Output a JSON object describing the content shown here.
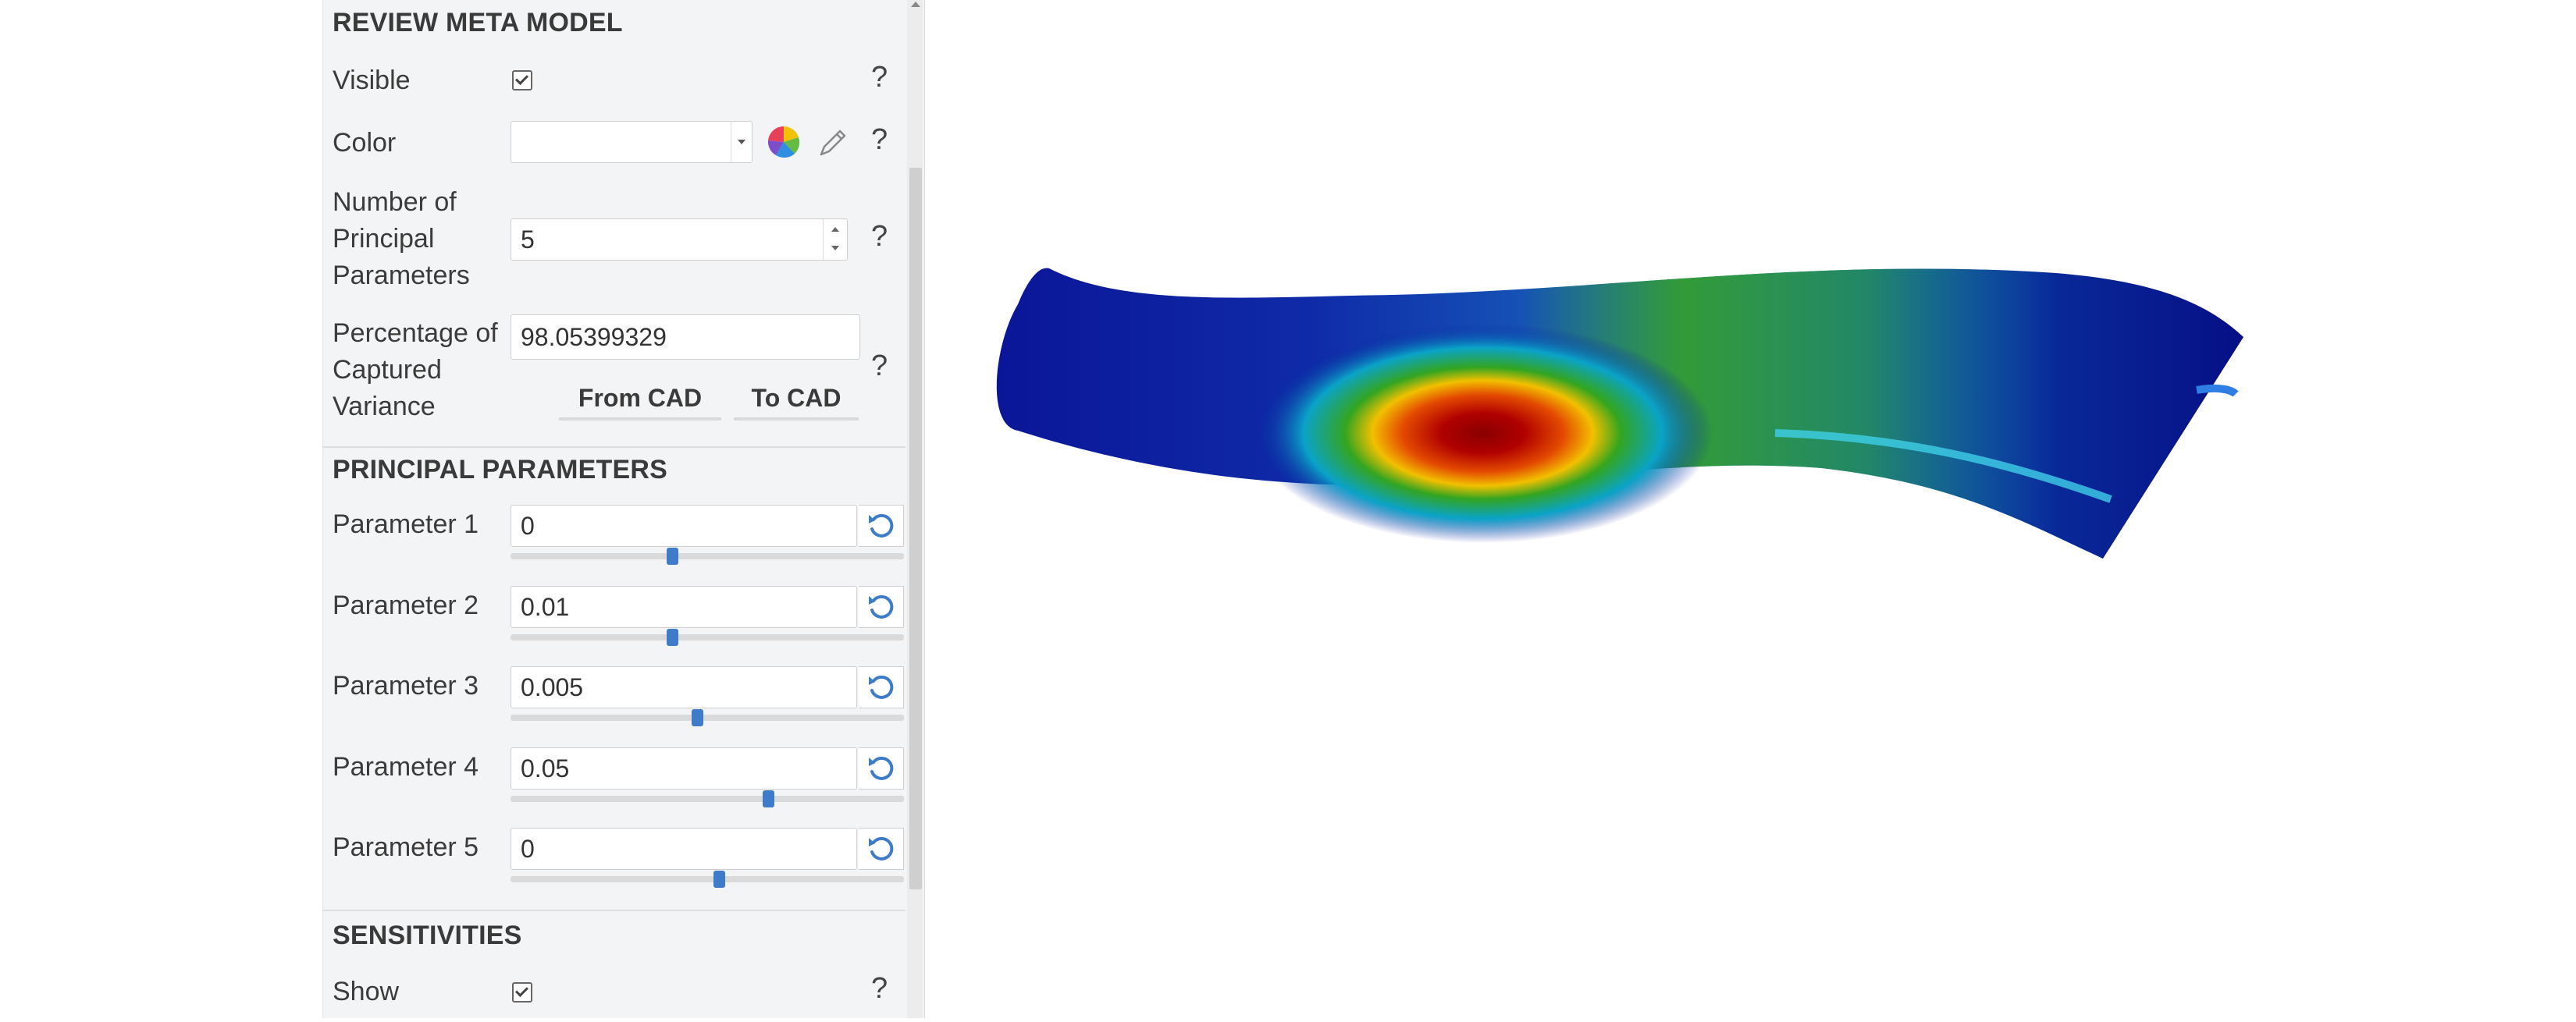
{
  "review_meta_model": {
    "title": "REVIEW META MODEL",
    "visible_label": "Visible",
    "color_label": "Color",
    "num_params_label_1": "Number of",
    "num_params_label_2": "Principal",
    "num_params_label_3": "Parameters",
    "num_params_value": "5",
    "variance_label_1": "Percentage of",
    "variance_label_2": "Captured",
    "variance_label_3": "Variance",
    "variance_value": "98.05399329",
    "from_cad": "From CAD",
    "to_cad": "To CAD",
    "help": "?"
  },
  "principal_parameters": {
    "title": "PRINCIPAL PARAMETERS",
    "items": [
      {
        "label": "Parameter 1",
        "value": "0",
        "slider_fraction": 0.41
      },
      {
        "label": "Parameter 2",
        "value": "0.01",
        "slider_fraction": 0.41
      },
      {
        "label": "Parameter 3",
        "value": "0.005",
        "slider_fraction": 0.475
      },
      {
        "label": "Parameter 4",
        "value": "0.05",
        "slider_fraction": 0.655
      },
      {
        "label": "Parameter 5",
        "value": "0",
        "slider_fraction": 0.53
      }
    ]
  },
  "sensitivities": {
    "title": "SENSITIVITIES",
    "show_label": "Show",
    "help": "?"
  },
  "colors": {
    "accent": "#3d7cc9",
    "panel_bg": "#f3f4f5"
  },
  "icons": [
    "checkbox-checked-icon",
    "color-wheel-icon",
    "pencil-icon",
    "reset-icon",
    "dropdown-arrow-icon"
  ]
}
